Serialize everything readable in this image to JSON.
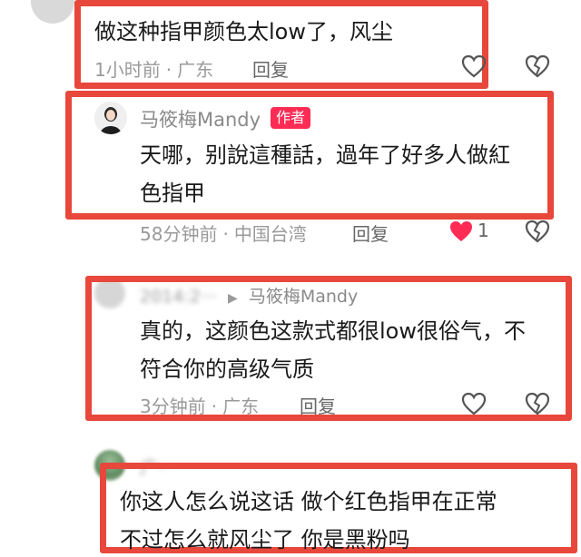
{
  "comments": [
    {
      "text": "做这种指甲颜色太low了，风尘",
      "time": "1小时前",
      "location": "广东",
      "reply_label": "回复"
    },
    {
      "author": "马筱梅Mandy",
      "badge": "作者",
      "text_line1": "天哪，别說這種話，過年了好多人做紅",
      "text_line2": "色指甲",
      "time": "58分钟前",
      "location": "中国台湾",
      "reply_label": "回复",
      "like_count": "1"
    },
    {
      "author_blurred": "2014:2···",
      "reply_to": "马筱梅Mandy",
      "text_line1": "真的，这颜色这款式都很low很俗气，不",
      "text_line2": "符合你的高级气质",
      "time": "3分钟前",
      "location": "广东",
      "reply_label": "回复"
    },
    {
      "author_blurred": "广·",
      "text_line1": "你这人怎么说这话 做个红色指甲在正常",
      "text_line2": "不过怎么就风尘了 你是黑粉吗"
    }
  ],
  "colors": {
    "highlight": "#e8473c",
    "like_active": "#fe2c55",
    "badge": "#fe2c55"
  }
}
